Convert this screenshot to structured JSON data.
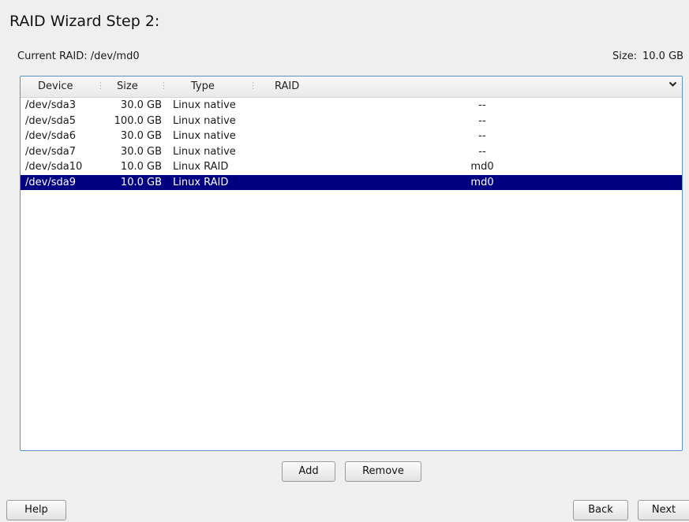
{
  "wizard": {
    "title": "RAID Wizard Step 2:",
    "current_raid_label": "Current RAID: /dev/md0",
    "size_label": "Size:",
    "size_value": "10.0 GB"
  },
  "table": {
    "columns": [
      "Device",
      "Size",
      "Type",
      "RAID"
    ],
    "rows": [
      {
        "device": "/dev/sda3",
        "size": "30.0 GB",
        "type": "Linux native",
        "raid": "--",
        "selected": false
      },
      {
        "device": "/dev/sda5",
        "size": "100.0 GB",
        "type": "Linux native",
        "raid": "--",
        "selected": false
      },
      {
        "device": "/dev/sda6",
        "size": "30.0 GB",
        "type": "Linux native",
        "raid": "--",
        "selected": false
      },
      {
        "device": "/dev/sda7",
        "size": "30.0 GB",
        "type": "Linux native",
        "raid": "--",
        "selected": false
      },
      {
        "device": "/dev/sda10",
        "size": "10.0 GB",
        "type": "Linux RAID",
        "raid": "md0",
        "selected": false
      },
      {
        "device": "/dev/sda9",
        "size": "10.0 GB",
        "type": "Linux RAID",
        "raid": "md0",
        "selected": true
      }
    ],
    "sort_icon": "chevron-down-icon"
  },
  "buttons": {
    "add": "Add",
    "remove": "Remove",
    "help": "Help",
    "back": "Back",
    "next": "Next"
  },
  "colors": {
    "selection": "#000080",
    "frame_border": "#5d8fca",
    "background": "#efefef"
  }
}
